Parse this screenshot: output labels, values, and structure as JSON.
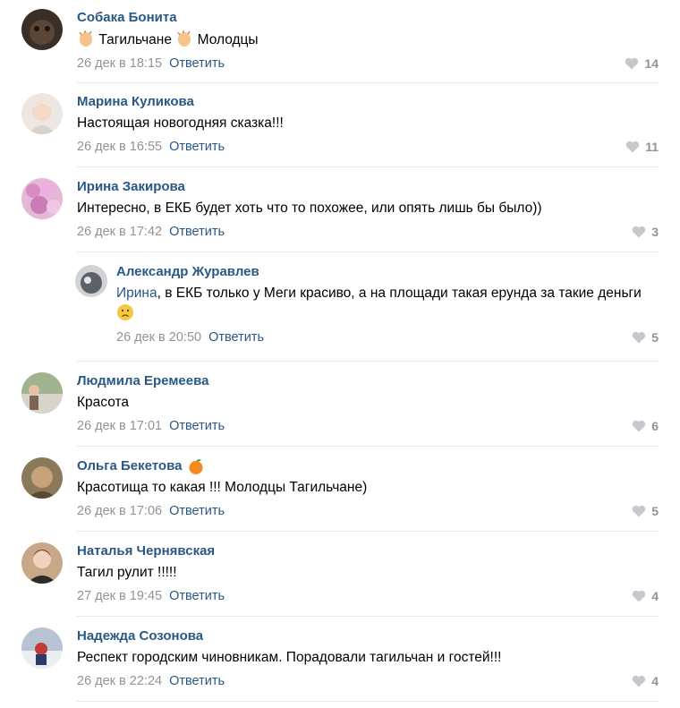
{
  "comments": [
    {
      "author": "Собака Бонита",
      "text_parts": [
        "Тагильчане",
        "Молодцы"
      ],
      "date": "26 дек в 18:15",
      "reply_label": "Ответить",
      "likes": "14"
    },
    {
      "author": "Марина Куликова",
      "text": "Настоящая новогодняя сказка!!!",
      "date": "26 дек в 16:55",
      "reply_label": "Ответить",
      "likes": "11"
    },
    {
      "author": "Ирина Закирова",
      "text": "Интересно, в ЕКБ будет хоть что то похожее, или опять лишь бы было))",
      "date": "26 дек в 17:42",
      "reply_label": "Ответить",
      "likes": "3"
    },
    {
      "author": "Александр Журавлев",
      "mention": "Ирина",
      "text": ", в ЕКБ только у Меги красиво, а на площади такая ерунда за такие деньги",
      "date": "26 дек в 20:50",
      "reply_label": "Ответить",
      "likes": "5"
    },
    {
      "author": "Людмила Еремеева",
      "text": "Красота",
      "date": "26 дек в 17:01",
      "reply_label": "Ответить",
      "likes": "6"
    },
    {
      "author": "Ольга Бекетова",
      "text": "Красотища то какая !!! Молодцы Тагильчане)",
      "date": "26 дек в 17:06",
      "reply_label": "Ответить",
      "likes": "5"
    },
    {
      "author": "Наталья Чернявская",
      "text": "Тагил рулит !!!!!",
      "date": "27 дек в 19:45",
      "reply_label": "Ответить",
      "likes": "4"
    },
    {
      "author": "Надежда Созонова",
      "text": "Респект городским чиновникам. Порадовали тагильчан и гостей!!!",
      "date": "26 дек в 22:24",
      "reply_label": "Ответить",
      "likes": "4"
    }
  ],
  "colors": {
    "author": "#2a5885",
    "meta": "#939393",
    "divider": "#e7e8ec"
  }
}
